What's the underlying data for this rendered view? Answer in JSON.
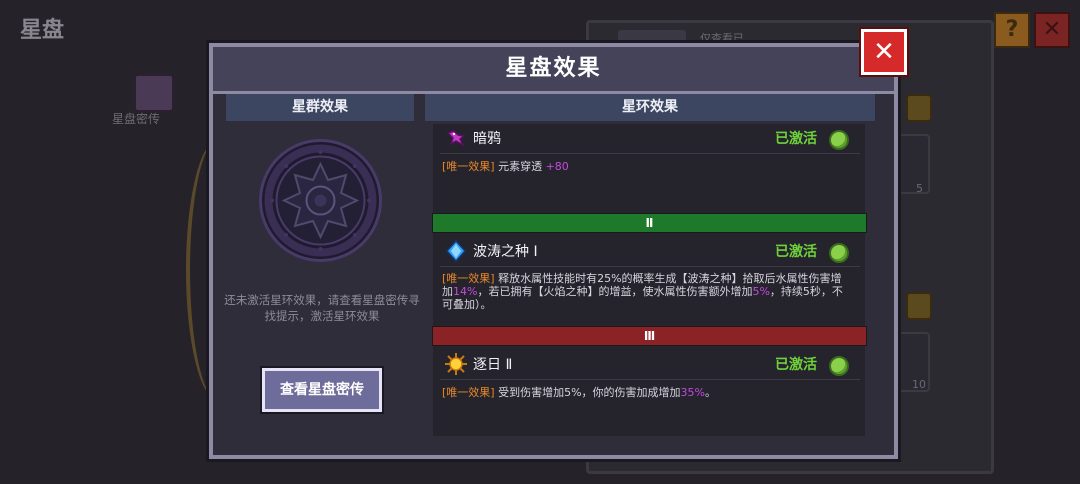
{
  "background": {
    "screen_title": "星盘",
    "help_label": "?",
    "close_label": "✕",
    "side_item_label": "星盘密传",
    "tab_label": "仅查看已",
    "slot_counts": [
      "5",
      "10"
    ]
  },
  "modal": {
    "title": "星盘效果",
    "close_label": "✕",
    "left": {
      "header": "星群效果",
      "hint": "还未激活星环效果，请查看星盘密传寻找提示，激活星环效果",
      "lore_button": "查看星盘密传"
    },
    "right": {
      "header": "星环效果",
      "effects": [
        {
          "name": "暗鸦",
          "status": "已激活",
          "icon": "crow-icon",
          "tag": "[唯一效果]",
          "desc_parts": [
            " 元素穿透 ",
            "+80",
            ""
          ]
        },
        {
          "name": "波涛之种 Ⅰ",
          "status": "已激活",
          "icon": "water-crystal-icon",
          "tag": "[唯一效果]",
          "desc_parts": [
            " 释放水属性技能时有25%的概率生成【波涛之种】拾取后水属性伤害增加",
            "14%",
            "，若已拥有【火焰之种】的增益，使水属性伤害额外增加",
            "5%",
            "，持续5秒，不可叠加）。"
          ]
        },
        {
          "name": "逐日 Ⅱ",
          "status": "已激活",
          "icon": "sun-icon",
          "tag": "[唯一效果]",
          "desc_parts": [
            " 受到伤害增加5%，你的伤害加成增加",
            "35%",
            "。"
          ]
        }
      ],
      "dividers": [
        "Ⅱ",
        "Ⅲ"
      ]
    }
  },
  "colors": {
    "active_green": "#6fd23a",
    "tag_orange": "#e8882a",
    "highlight_purple": "#c44ae0",
    "divider_green": "#1e7a2a",
    "divider_red": "#8a2226"
  }
}
